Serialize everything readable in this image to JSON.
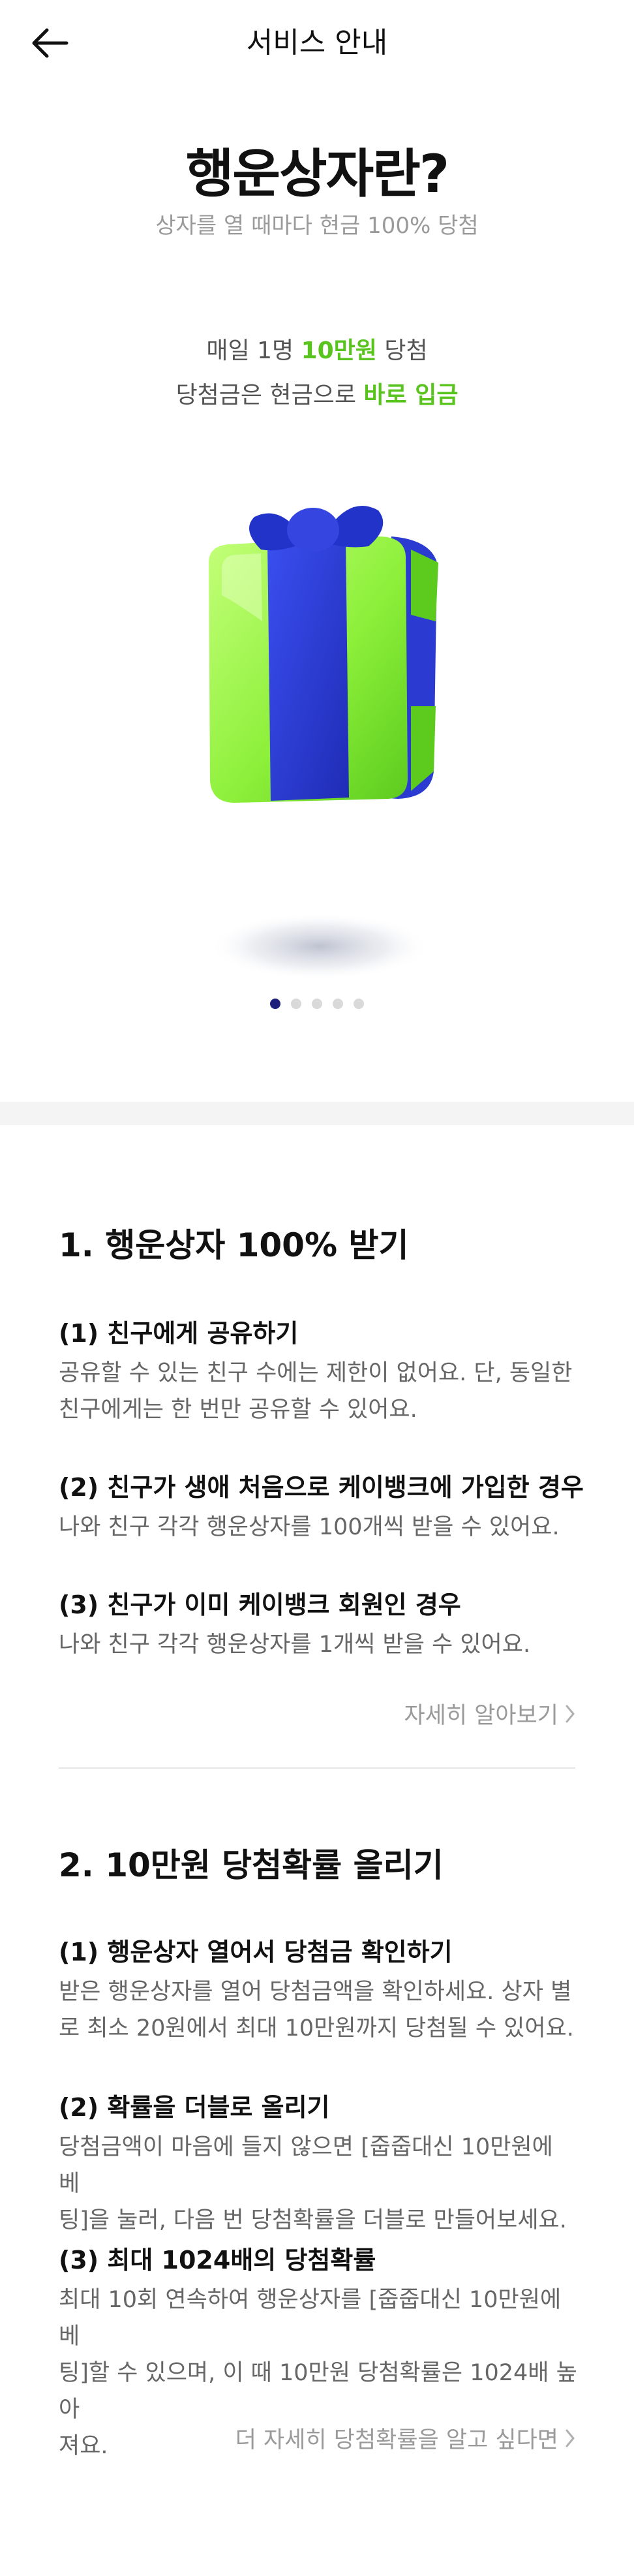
{
  "header": {
    "title": "서비스 안내"
  },
  "hero": {
    "title": "행운상자란?",
    "subtitle": "상자를 열 때마다 현금 100% 당첨",
    "line1_pre": "매일 1명 ",
    "line1_hl": "10만원",
    "line1_post": " 당첨",
    "line2_pre": "당첨금은 현금으로 ",
    "line2_hl": "바로 입금",
    "carousel": {
      "count": 5,
      "active_index": 0
    },
    "colors": {
      "highlight": "#58c41d",
      "gift_green": "#8df03a",
      "gift_blue": "#2b3ad1"
    }
  },
  "sections": [
    {
      "title": "1. 행운상자 100% 받기",
      "items": [
        {
          "title": "(1) 친구에게 공유하기",
          "body": [
            "공유할 수 있는 친구 수에는 제한이 없어요. 단, 동일한",
            "친구에게는 한 번만 공유할 수 있어요."
          ]
        },
        {
          "title": "(2) 친구가 생애 처음으로 케이뱅크에 가입한 경우",
          "body": [
            "나와 친구 각각 행운상자를 100개씩 받을 수 있어요."
          ]
        },
        {
          "title": "(3) 친구가 이미 케이뱅크 회원인 경우",
          "body": [
            "나와 친구 각각 행운상자를 1개씩 받을 수 있어요."
          ]
        }
      ],
      "link": "자세히 알아보기"
    },
    {
      "title": "2. 10만원 당첨확률 올리기",
      "items": [
        {
          "title": "(1) 행운상자 열어서 당첨금 확인하기",
          "body": [
            "받은 행운상자를 열어 당첨금액을 확인하세요. 상자 별",
            "로 최소 20원에서 최대 10만원까지 당첨될 수 있어요."
          ]
        },
        {
          "title": "(2) 확률을 더블로 올리기",
          "body": [
            "당첨금액이 마음에 들지 않으면 [줍줍대신 10만원에 베",
            "팅]을 눌러, 다음 번 당첨확률을 더블로 만들어보세요."
          ]
        },
        {
          "title": "(3) 최대 1024배의 당첨확률",
          "body": [
            "최대 10회 연속하여 행운상자를 [줍줍대신 10만원에 베",
            "팅]할 수 있으며, 이 때 10만원 당첨확률은 1024배 높아",
            "져요."
          ]
        }
      ],
      "link": "더 자세히 당첨확률을 알고 싶다면"
    }
  ],
  "icons": {
    "back": "arrow-left-icon",
    "chevron": "chevron-right-icon",
    "gift": "gift-box-illustration"
  }
}
